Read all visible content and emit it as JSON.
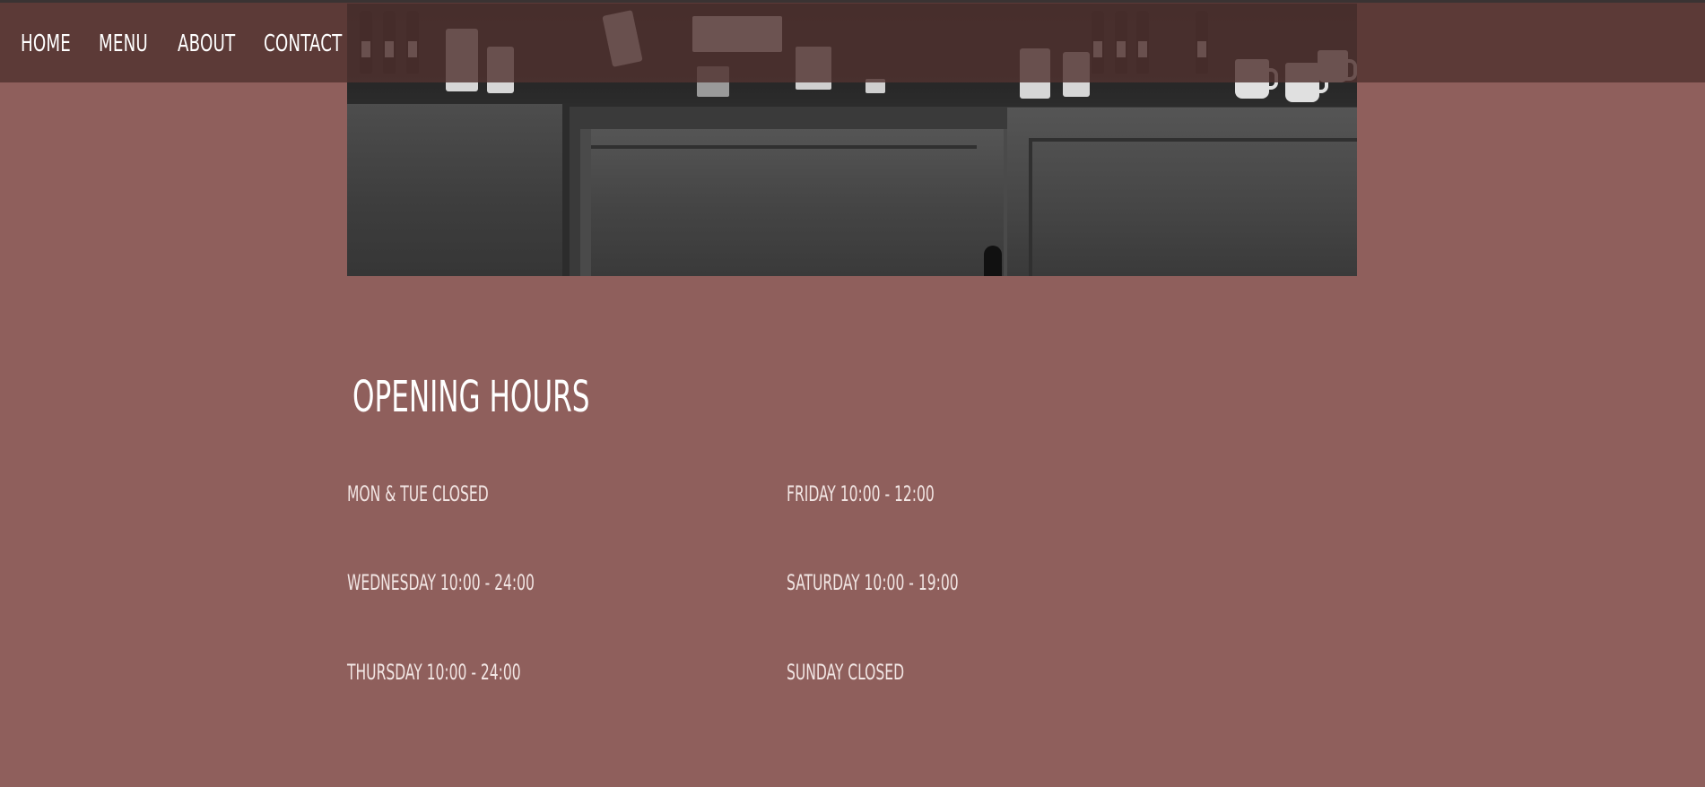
{
  "colors": {
    "background": "#8f5f5c",
    "nav_background": "#503230",
    "text": "#ffffff"
  },
  "nav": {
    "items": [
      {
        "label": "HOME"
      },
      {
        "label": "MENU"
      },
      {
        "label": "ABOUT"
      },
      {
        "label": "CONTACT"
      }
    ]
  },
  "hours": {
    "title": "OPENING HOURS",
    "entries": [
      {
        "text": "MON & TUE CLOSED"
      },
      {
        "text": "FRIDAY 10:00 - 12:00"
      },
      {
        "text": "WEDNESDAY 10:00 - 24:00"
      },
      {
        "text": "SATURDAY 10:00 - 19:00"
      },
      {
        "text": "THURSDAY 10:00 - 24:00"
      },
      {
        "text": "SUNDAY CLOSED"
      }
    ]
  }
}
